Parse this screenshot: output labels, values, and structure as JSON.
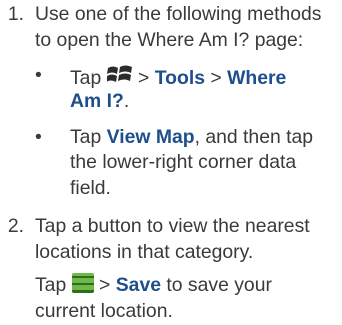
{
  "step1": {
    "number": "1.",
    "lines": [
      "Use one of the following methods",
      "to open the Where Am I? page:"
    ],
    "bullet1": {
      "symbol": "•",
      "tap": "Tap",
      "sep": ">",
      "tools": "Tools",
      "where": "Where",
      "where2": "Am I?",
      "period": "."
    },
    "bullet2": {
      "symbol": "•",
      "tap": "Tap",
      "view_map": "View Map",
      "rest1": ", and then tap",
      "line2": "the lower-right corner data",
      "line3": "field."
    }
  },
  "step2": {
    "number": "2.",
    "lines": [
      "Tap a button to view the nearest",
      "locations in that category."
    ],
    "tap": "Tap",
    "sep": ">",
    "save": "Save",
    "rest": "to save your",
    "line2": "current location."
  },
  "icons": {
    "windows": "windows-start-icon",
    "menu": "menu-icon"
  },
  "colors": {
    "text": "#3a3a3a",
    "link": "#1e4f8c"
  }
}
